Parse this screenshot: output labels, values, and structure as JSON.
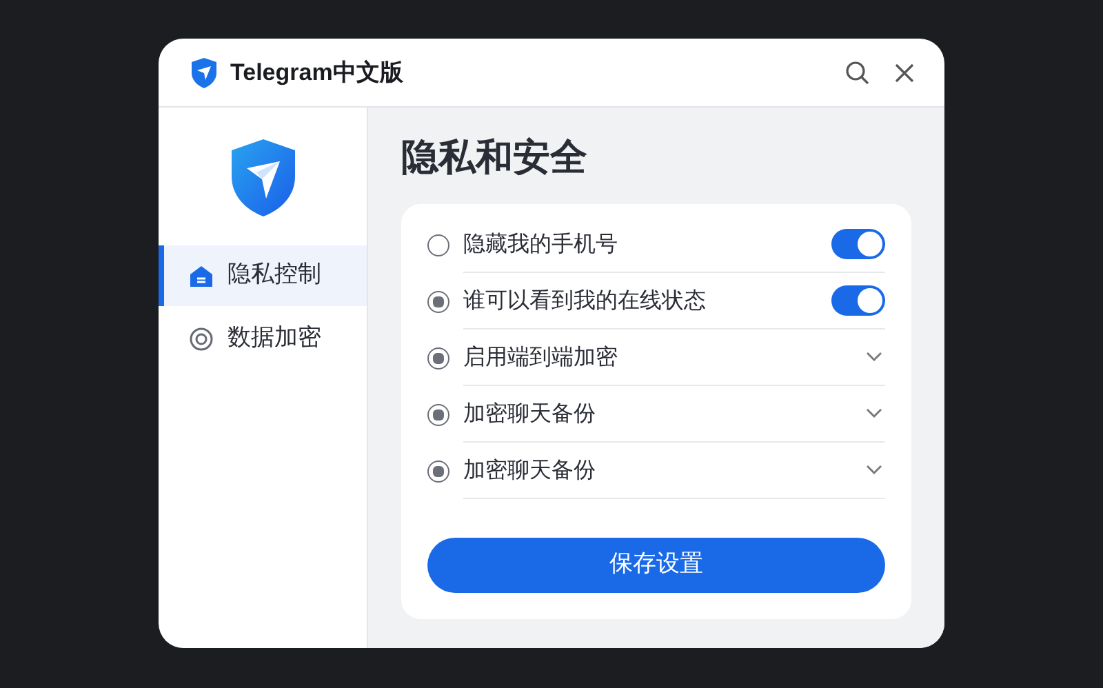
{
  "window": {
    "title": "Telegram中文版"
  },
  "sidebar": {
    "items": [
      {
        "label": "隐私控制",
        "selected": true,
        "kind": "home"
      },
      {
        "label": "数据加密",
        "selected": false,
        "kind": "target"
      }
    ]
  },
  "heading": "隐私和安全",
  "settings": [
    {
      "label": "隐藏我的手机号",
      "checked": false,
      "kind": "toggle",
      "on": true
    },
    {
      "label": "谁可以看到我的在线状态",
      "checked": true,
      "kind": "toggle",
      "on": true
    },
    {
      "label": "启用端到端加密",
      "checked": true,
      "kind": "dropdown"
    },
    {
      "label": "加密聊天备份",
      "checked": true,
      "kind": "dropdown"
    },
    {
      "label": "加密聊天备份",
      "checked": true,
      "kind": "dropdown"
    }
  ],
  "save_button": "保存设置"
}
